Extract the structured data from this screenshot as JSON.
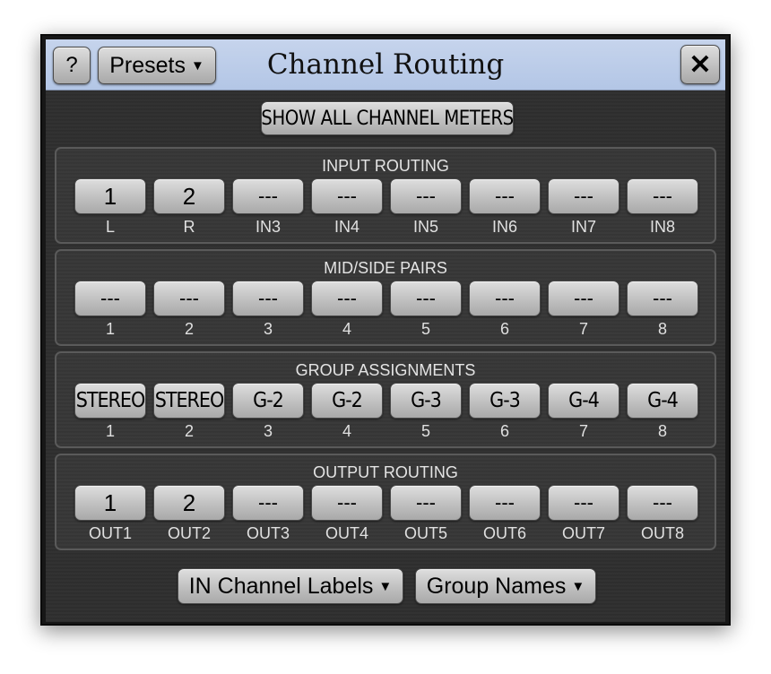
{
  "window": {
    "title": "Channel Routing",
    "help_label": "?",
    "presets_label": "Presets",
    "close_label": "✕"
  },
  "show_all_label": "SHOW ALL CHANNEL METERS",
  "sections": [
    {
      "title": "INPUT ROUTING",
      "channels": [
        {
          "value": "1",
          "label": "L"
        },
        {
          "value": "2",
          "label": "R"
        },
        {
          "value": "---",
          "label": "IN3"
        },
        {
          "value": "---",
          "label": "IN4"
        },
        {
          "value": "---",
          "label": "IN5"
        },
        {
          "value": "---",
          "label": "IN6"
        },
        {
          "value": "---",
          "label": "IN7"
        },
        {
          "value": "---",
          "label": "IN8"
        }
      ]
    },
    {
      "title": "MID/SIDE PAIRS",
      "channels": [
        {
          "value": "---",
          "label": "1"
        },
        {
          "value": "---",
          "label": "2"
        },
        {
          "value": "---",
          "label": "3"
        },
        {
          "value": "---",
          "label": "4"
        },
        {
          "value": "---",
          "label": "5"
        },
        {
          "value": "---",
          "label": "6"
        },
        {
          "value": "---",
          "label": "7"
        },
        {
          "value": "---",
          "label": "8"
        }
      ]
    },
    {
      "title": "GROUP ASSIGNMENTS",
      "channels": [
        {
          "value": "STEREO",
          "label": "1"
        },
        {
          "value": "STEREO",
          "label": "2"
        },
        {
          "value": "G-2",
          "label": "3"
        },
        {
          "value": "G-2",
          "label": "4"
        },
        {
          "value": "G-3",
          "label": "5"
        },
        {
          "value": "G-3",
          "label": "6"
        },
        {
          "value": "G-4",
          "label": "7"
        },
        {
          "value": "G-4",
          "label": "8"
        }
      ]
    },
    {
      "title": "OUTPUT ROUTING",
      "channels": [
        {
          "value": "1",
          "label": "OUT1"
        },
        {
          "value": "2",
          "label": "OUT2"
        },
        {
          "value": "---",
          "label": "OUT3"
        },
        {
          "value": "---",
          "label": "OUT4"
        },
        {
          "value": "---",
          "label": "OUT5"
        },
        {
          "value": "---",
          "label": "OUT6"
        },
        {
          "value": "---",
          "label": "OUT7"
        },
        {
          "value": "---",
          "label": "OUT8"
        }
      ]
    }
  ],
  "footer": {
    "channel_labels": "IN Channel Labels",
    "group_names": "Group Names"
  }
}
